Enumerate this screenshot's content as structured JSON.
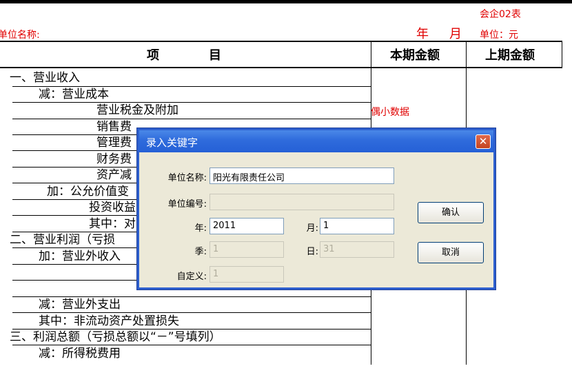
{
  "report": {
    "form_code": "会企02表",
    "unit_name_label": "单位名称:",
    "year_label": "年",
    "month_label": "月",
    "unit_label": "单位：元",
    "col_item": "项　　　　目",
    "col_current": "本期金额",
    "col_previous": "上期金额",
    "rows": [
      "一、营业收入",
      "减：营业成本",
      "营业税金及附加",
      "销售费",
      "管理费",
      "财务费",
      "资产减",
      "加：公允价值变",
      "投资收益",
      "其中：对",
      "二、营业利润（亏损",
      "加：营业外收入",
      "减：营业外支出",
      "其中：非流动资产处置损失",
      "三、利润总额（亏损总额以“－”号填列）",
      "减：所得税费用"
    ],
    "ghost_text": "偶小数据"
  },
  "dialog": {
    "title": "录入关键字",
    "close_glyph": "✕",
    "fields": {
      "unit_name_label": "单位名称:",
      "unit_name_value": "阳光有限责任公司",
      "unit_code_label": "单位编号:",
      "unit_code_value": "",
      "year_label": "年:",
      "year_value": "2011",
      "month_label": "月:",
      "month_value": "1",
      "quarter_label": "季:",
      "quarter_value": "1",
      "day_label": "日:",
      "day_value": "31",
      "custom_label": "自定义:",
      "custom_value": "1"
    },
    "ok_label": "确认",
    "cancel_label": "取消"
  }
}
